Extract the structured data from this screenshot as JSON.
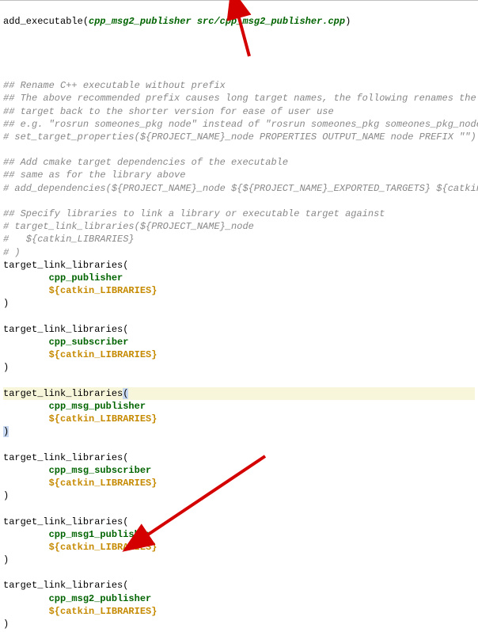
{
  "line_addexec": {
    "fn": "add_executable",
    "args": "cpp_msg2_publisher src/cpp_msg2_publisher.cpp"
  },
  "comments_rename": [
    "## Rename C++ executable without prefix",
    "## The above recommended prefix causes long target names, the following renames the",
    "## target back to the shorter version for ease of user use",
    "## e.g. \"rosrun someones_pkg node\" instead of \"rosrun someones_pkg someones_pkg_node\"",
    "# set_target_properties(${PROJECT_NAME}_node PROPERTIES OUTPUT_NAME node PREFIX \"\")"
  ],
  "comments_deps": [
    "## Add cmake target dependencies of the executable",
    "## same as for the library above",
    "# add_dependencies(${PROJECT_NAME}_node ${${PROJECT_NAME}_EXPORTED_TARGETS} ${catkin_E"
  ],
  "comments_link": [
    "## Specify libraries to link a library or executable target against",
    "# target_link_libraries(${PROJECT_NAME}_node",
    "#   ${catkin_LIBRARIES}",
    "# )"
  ],
  "tll_blocks": [
    {
      "target": "cpp_publisher",
      "lib_var": "catkin_LIBRARIES",
      "highlighted": false
    },
    {
      "target": "cpp_subscriber",
      "lib_var": "catkin_LIBRARIES",
      "highlighted": false
    },
    {
      "target": "cpp_msg_publisher",
      "lib_var": "catkin_LIBRARIES",
      "highlighted": true
    },
    {
      "target": "cpp_msg_subscriber",
      "lib_var": "catkin_LIBRARIES",
      "highlighted": false
    },
    {
      "target": "cpp_msg1_publisher",
      "lib_var": "catkin_LIBRARIES",
      "highlighted": false
    },
    {
      "target": "cpp_msg2_publisher",
      "lib_var": "catkin_LIBRARIES",
      "highlighted": false
    }
  ],
  "fn_name": "target_link_libraries",
  "var_prefix": "${",
  "var_suffix": "}",
  "indent": "        "
}
